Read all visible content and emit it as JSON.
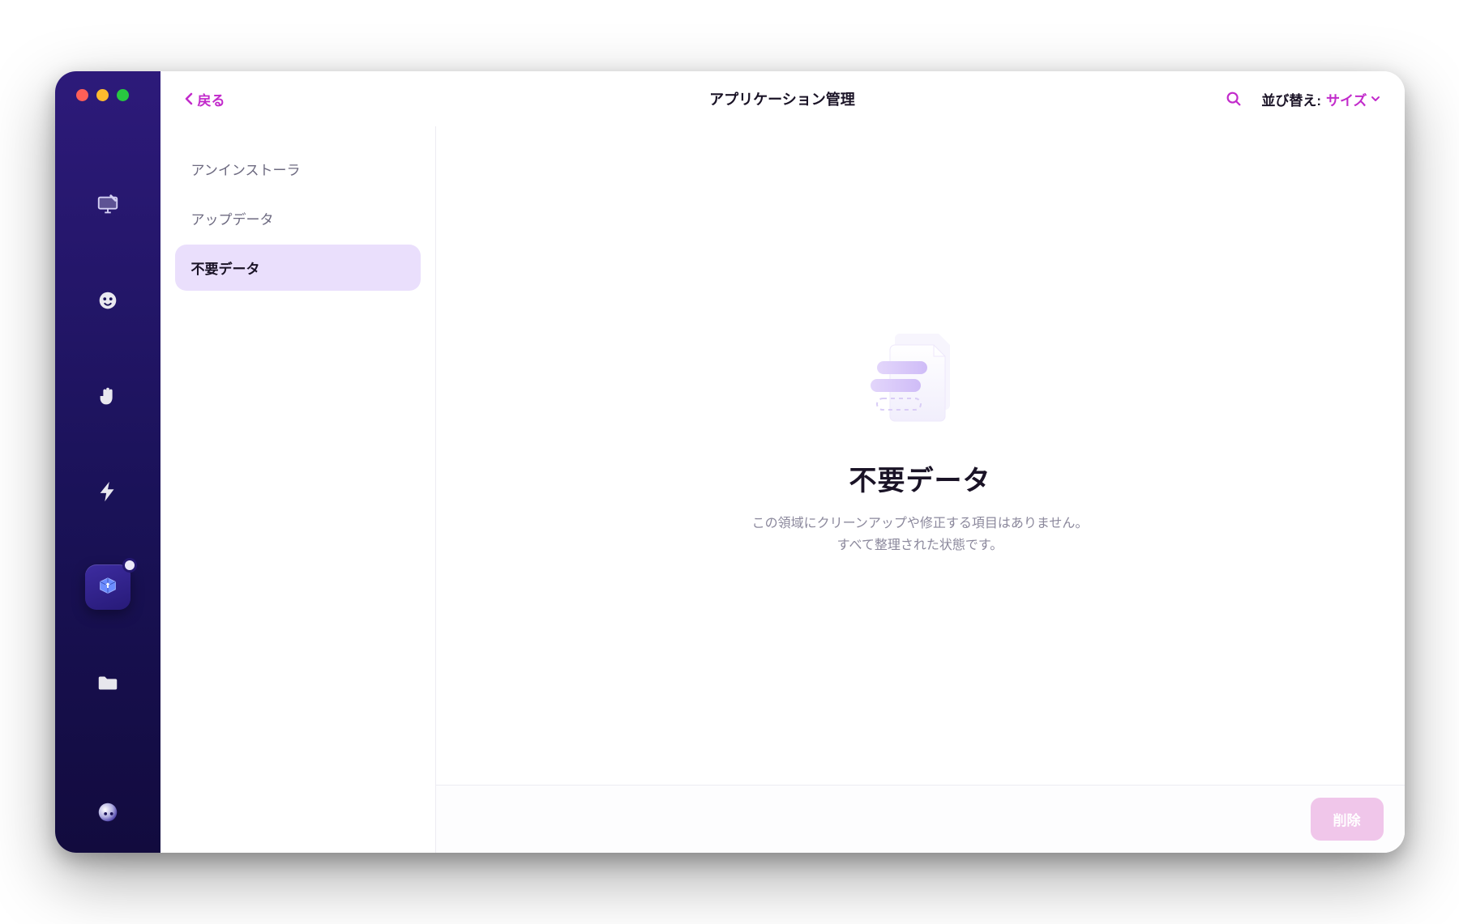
{
  "window": {
    "title": "アプリケーション管理",
    "back_label": "戻る",
    "sort_label": "並び替え:",
    "sort_value": "サイズ"
  },
  "rail": {
    "items": [
      {
        "name": "cleanup",
        "icon": "imac-brush-icon"
      },
      {
        "name": "protection",
        "icon": "face-shield-icon"
      },
      {
        "name": "privacy",
        "icon": "hand-stop-icon"
      },
      {
        "name": "speed",
        "icon": "lightning-icon"
      },
      {
        "name": "applications",
        "icon": "app-box-icon",
        "active": true,
        "badge": true
      },
      {
        "name": "files",
        "icon": "folder-icon"
      }
    ],
    "bottom": {
      "name": "assistant",
      "icon": "orb-icon"
    }
  },
  "subnav": {
    "items": [
      {
        "label": "アンインストーラ",
        "selected": false
      },
      {
        "label": "アップデータ",
        "selected": false
      },
      {
        "label": "不要データ",
        "selected": true
      }
    ]
  },
  "content": {
    "empty_title": "不要データ",
    "empty_line1": "この領域にクリーンアップや修正する項目はありません。",
    "empty_line2": "すべて整理された状態です。"
  },
  "footer": {
    "delete_label": "削除"
  },
  "colors": {
    "accent": "#c22bcb",
    "rail_gradient_top": "#2d1a7a",
    "rail_gradient_bottom": "#120b3e",
    "subnav_selected_bg": "#eadffc"
  }
}
